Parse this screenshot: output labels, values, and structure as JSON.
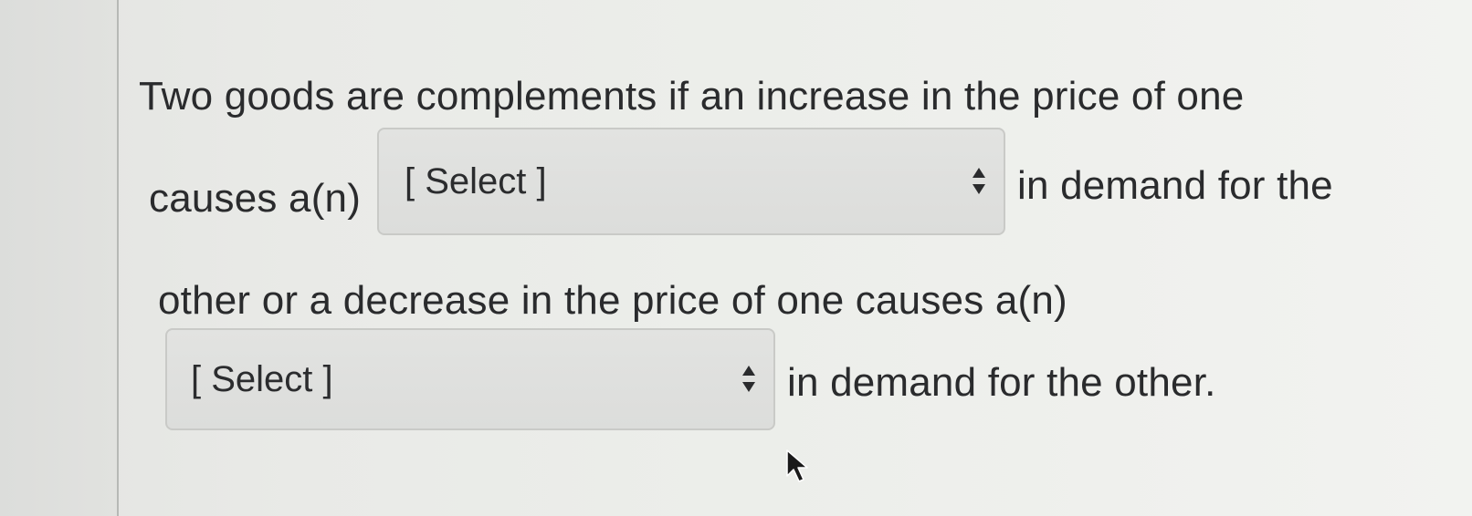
{
  "question": {
    "line1": "Two goods are complements if an increase in the price of one",
    "line2_before": "causes a(n)",
    "line2_after": "in demand for the",
    "line3": "other or a decrease in the price of one causes a(n)",
    "line4_after": "in demand for the other."
  },
  "selects": [
    {
      "value": "[ Select ]"
    },
    {
      "value": "[ Select ]"
    }
  ],
  "icons": {
    "select_chevron": "up-down-chevron-icon",
    "cursor": "mouse-pointer-icon"
  },
  "colors": {
    "text": "#2a2b2d",
    "select_bg": "#dfe0de",
    "select_border": "#c9cac7"
  }
}
